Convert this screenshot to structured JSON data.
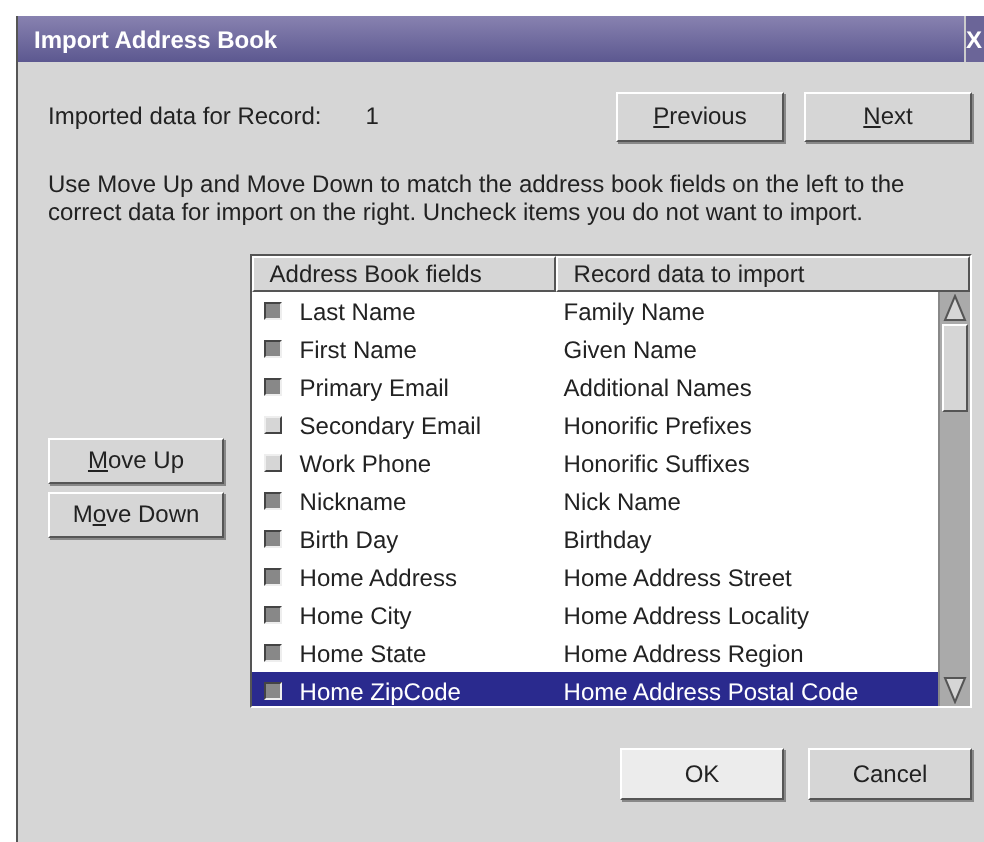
{
  "window": {
    "title": "Import Address Book",
    "close": "X"
  },
  "record": {
    "label": "Imported data for Record:",
    "value": "1"
  },
  "nav_buttons": [
    {
      "mnemonic": "P",
      "rest": "revious"
    },
    {
      "mnemonic": "N",
      "rest": "ext"
    }
  ],
  "instructions": "Use Move Up and Move Down to match the address book fields on the left to the correct data for import on the right. Uncheck items you do not want to import.",
  "move_buttons": [
    {
      "mnemonic": "M",
      "rest": "ove Up"
    },
    {
      "lead": "M",
      "mnemonic": "o",
      "rest": "ve Down"
    }
  ],
  "table": {
    "columns": [
      "Address Book fields",
      "Record data to import"
    ],
    "rows": [
      {
        "field": "Last Name",
        "data": "Family Name",
        "checked": true,
        "selected": false
      },
      {
        "field": "First Name",
        "data": "Given Name",
        "checked": true,
        "selected": false
      },
      {
        "field": "Primary Email",
        "data": "Additional Names",
        "checked": true,
        "selected": false
      },
      {
        "field": "Secondary Email",
        "data": "Honorific Prefixes",
        "checked": false,
        "selected": false
      },
      {
        "field": "Work Phone",
        "data": "Honorific Suffixes",
        "checked": false,
        "selected": false
      },
      {
        "field": "Nickname",
        "data": "Nick Name",
        "checked": true,
        "selected": false
      },
      {
        "field": "Birth Day",
        "data": "Birthday",
        "checked": true,
        "selected": false
      },
      {
        "field": "Home Address",
        "data": "Home Address Street",
        "checked": true,
        "selected": false
      },
      {
        "field": "Home City",
        "data": "Home Address Locality",
        "checked": true,
        "selected": false
      },
      {
        "field": "Home State",
        "data": "Home Address Region",
        "checked": true,
        "selected": false
      },
      {
        "field": "Home ZipCode",
        "data": "Home Address Postal Code",
        "checked": true,
        "selected": true
      }
    ]
  },
  "dialog_buttons": [
    {
      "label": "OK"
    },
    {
      "label": "Cancel"
    }
  ]
}
